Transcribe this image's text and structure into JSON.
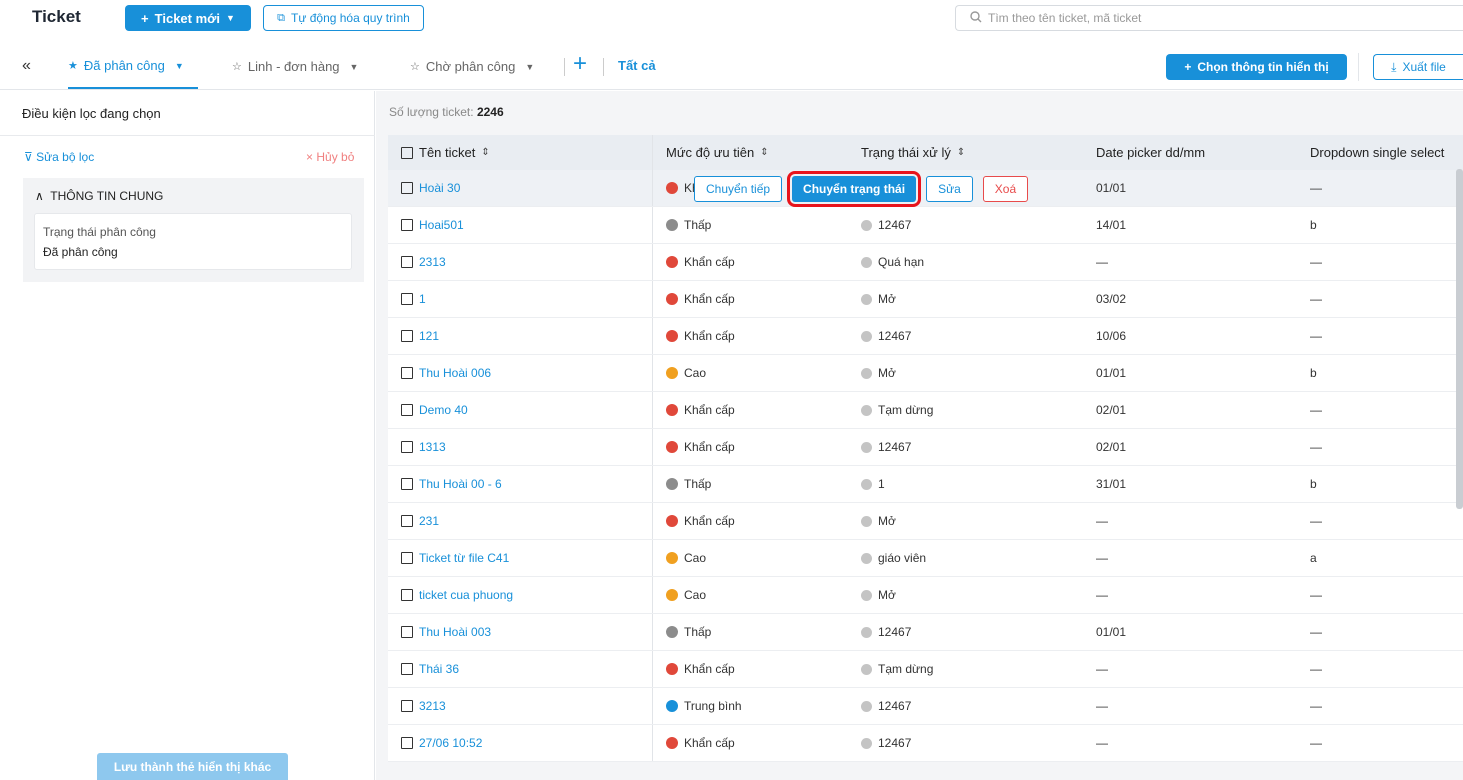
{
  "app": {
    "title": "Ticket"
  },
  "topbar": {
    "new_ticket": "Ticket mới",
    "automation": "Tự động hóa quy trình",
    "search_placeholder": "Tìm theo tên ticket, mã ticket"
  },
  "tabs": [
    {
      "label": "Đã phân công",
      "active": true
    },
    {
      "label": "Linh - đơn hàng",
      "active": false
    },
    {
      "label": "Chờ phân công",
      "active": false
    }
  ],
  "tab_all": "Tất cả",
  "toolbar": {
    "choose_display": "Chọn thông tin hiển thị",
    "export": "Xuất file"
  },
  "sidebar": {
    "title": "Điều kiện lọc đang chọn",
    "edit_filter": "Sửa bộ lọc",
    "cancel": "Hủy bỏ",
    "group_title": "THÔNG TIN CHUNG",
    "filter_label": "Trạng thái phân công",
    "filter_value": "Đã phân công",
    "save_view": "Lưu thành thẻ hiển thị khác"
  },
  "main": {
    "count_label": "Số lượng ticket:",
    "count_value": "2246"
  },
  "columns": {
    "name": "Tên ticket",
    "priority": "Mức độ ưu tiên",
    "status": "Trạng thái xử lý",
    "date": "Date picker dd/mm",
    "dropdown": "Dropdown single select"
  },
  "row_actions": {
    "forward": "Chuyển tiếp",
    "change_status": "Chuyển trạng thái",
    "edit": "Sửa",
    "delete": "Xoá"
  },
  "priority_colors": {
    "Khẩn cấp": "#e0483a",
    "Thấp": "#8c8c8c",
    "Cao": "#f0a020",
    "Trung bình": "#1890d9"
  },
  "rows": [
    {
      "name": "Hoài 30",
      "priority": "Khẩn cấp",
      "status": "",
      "date": "01/01",
      "dropdown": "—"
    },
    {
      "name": "Hoai501",
      "priority": "Thấp",
      "status": "12467",
      "date": "14/01",
      "dropdown": "b"
    },
    {
      "name": "2313",
      "priority": "Khẩn cấp",
      "status": "Quá hạn",
      "date": "—",
      "dropdown": "—"
    },
    {
      "name": "1",
      "priority": "Khẩn cấp",
      "status": "Mở",
      "date": "03/02",
      "dropdown": "—"
    },
    {
      "name": "121",
      "priority": "Khẩn cấp",
      "status": "12467",
      "date": "10/06",
      "dropdown": "—"
    },
    {
      "name": "Thu Hoài 006",
      "priority": "Cao",
      "status": "Mở",
      "date": "01/01",
      "dropdown": "b"
    },
    {
      "name": "Demo 40",
      "priority": "Khẩn cấp",
      "status": "Tạm dừng",
      "date": "02/01",
      "dropdown": "—"
    },
    {
      "name": "1313",
      "priority": "Khẩn cấp",
      "status": "12467",
      "date": "02/01",
      "dropdown": "—"
    },
    {
      "name": "Thu Hoài 00 - 6",
      "priority": "Thấp",
      "status": "1",
      "date": "31/01",
      "dropdown": "b"
    },
    {
      "name": "231",
      "priority": "Khẩn cấp",
      "status": "Mở",
      "date": "—",
      "dropdown": "—"
    },
    {
      "name": "Ticket từ file C41",
      "priority": "Cao",
      "status": "giáo viên",
      "date": "—",
      "dropdown": "a"
    },
    {
      "name": "ticket cua phuong",
      "priority": "Cao",
      "status": "Mở",
      "date": "—",
      "dropdown": "—"
    },
    {
      "name": "Thu Hoài 003",
      "priority": "Thấp",
      "status": "12467",
      "date": "01/01",
      "dropdown": "—"
    },
    {
      "name": "Thái 36",
      "priority": "Khẩn cấp",
      "status": "Tạm dừng",
      "date": "—",
      "dropdown": "—"
    },
    {
      "name": "3213",
      "priority": "Trung bình",
      "status": "12467",
      "date": "—",
      "dropdown": "—"
    },
    {
      "name": "27/06 10:52",
      "priority": "Khẩn cấp",
      "status": "12467",
      "date": "—",
      "dropdown": "—"
    }
  ]
}
